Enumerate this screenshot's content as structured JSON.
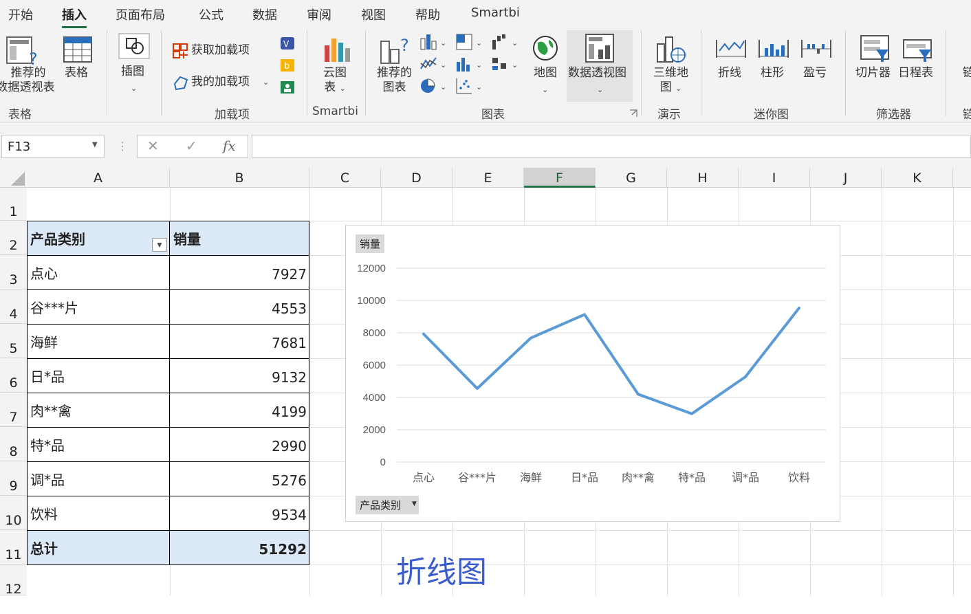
{
  "ribbon": {
    "tabs": [
      "开始",
      "插入",
      "页面布局",
      "公式",
      "数据",
      "审阅",
      "视图",
      "帮助",
      "Smartbi"
    ],
    "active_tab": "插入",
    "buttons": {
      "recommended_pivot": [
        "推荐的",
        "数据透视表"
      ],
      "table": "表格",
      "illustrations": "插图",
      "get_addins": "获取加载项",
      "my_addins": "我的加载项",
      "cloud_chart": [
        "云图",
        "表"
      ],
      "recommended_charts": [
        "推荐的",
        "图表"
      ],
      "map": "地图",
      "pivot_chart": "数据透视图",
      "3d_map": [
        "三维地",
        "图"
      ],
      "sparkline_line": "折线",
      "sparkline_column": "柱形",
      "sparkline_winloss": "盈亏",
      "slicer": "切片器",
      "timeline": "日程表",
      "cut_off": "链"
    },
    "groups": [
      "表格",
      "加载项",
      "Smartbi",
      "图表",
      "演示",
      "迷你图",
      "筛选器",
      "链"
    ]
  },
  "formula_bar": {
    "name_box": "F13",
    "formula": ""
  },
  "columns": [
    "A",
    "B",
    "C",
    "D",
    "E",
    "F",
    "G",
    "H",
    "I",
    "J",
    "K"
  ],
  "selected_column": "F",
  "rows": [
    "1",
    "2",
    "3",
    "4",
    "5",
    "6",
    "7",
    "8",
    "9",
    "10",
    "11",
    "12"
  ],
  "pivot_table": {
    "header": [
      "产品类别",
      "销量"
    ],
    "rows": [
      {
        "category": "点心",
        "value": "7927"
      },
      {
        "category": "谷***片",
        "value": "4553"
      },
      {
        "category": "海鲜",
        "value": "7681"
      },
      {
        "category": "日*品",
        "value": "9132"
      },
      {
        "category": "肉**禽",
        "value": "4199"
      },
      {
        "category": "特*品",
        "value": "2990"
      },
      {
        "category": "调*品",
        "value": "5276"
      },
      {
        "category": "饮料",
        "value": "9534"
      }
    ],
    "total": {
      "category": "总计",
      "value": "51292"
    }
  },
  "chart_data": {
    "type": "line",
    "categories": [
      "点心",
      "谷***片",
      "海鲜",
      "日*品",
      "肉**禽",
      "特*品",
      "调*品",
      "饮料"
    ],
    "series": [
      {
        "name": "销量",
        "values": [
          7927,
          4553,
          7681,
          9132,
          4199,
          2990,
          5276,
          9534
        ],
        "color": "#5b9bd5"
      }
    ],
    "ylim": [
      0,
      12000
    ],
    "yticks": [
      0,
      2000,
      4000,
      6000,
      8000,
      10000,
      12000
    ],
    "grid": true,
    "value_field_button": "销量",
    "axis_field_button": "产品类别"
  },
  "annotation": "折线图"
}
